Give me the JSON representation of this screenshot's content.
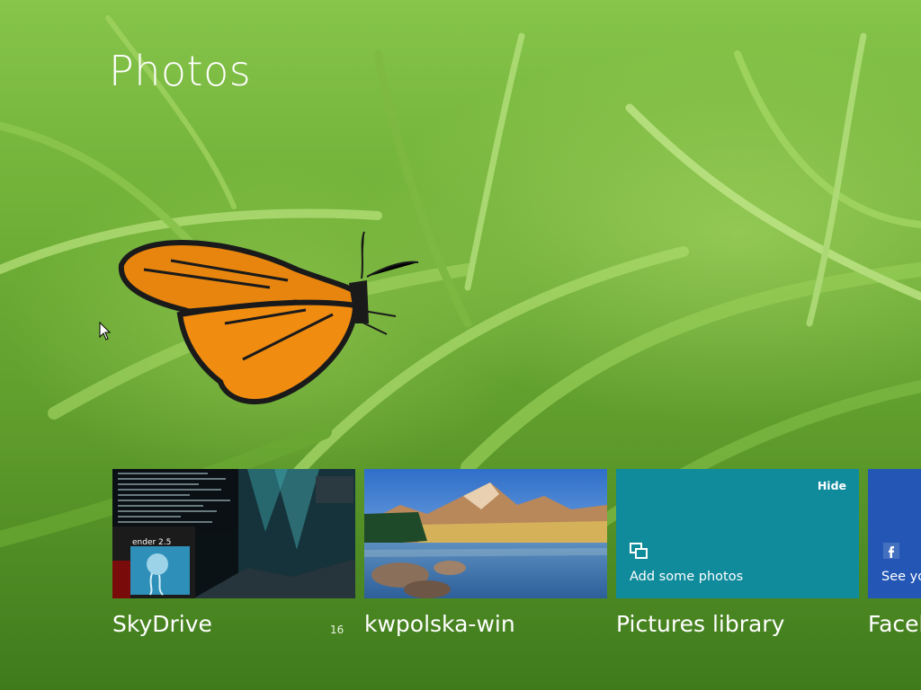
{
  "app": {
    "title": "Photos"
  },
  "tiles": [
    {
      "label": "SkyDrive",
      "count": "16"
    },
    {
      "label": "kwpolska-win"
    },
    {
      "label": "Pictures library",
      "hide": "Hide",
      "action": "Add some photos"
    },
    {
      "label": "Faceb",
      "action": "See yo"
    }
  ],
  "thumb_text": {
    "skydrive_window": "ender 2.5"
  },
  "colors": {
    "pictures_tile": "#0f8b9c",
    "facebook_tile": "#2457b5",
    "background_grass": "#6eae36"
  },
  "icons": [
    "add-photos-icon",
    "facebook-icon",
    "mouse-cursor-icon"
  ]
}
